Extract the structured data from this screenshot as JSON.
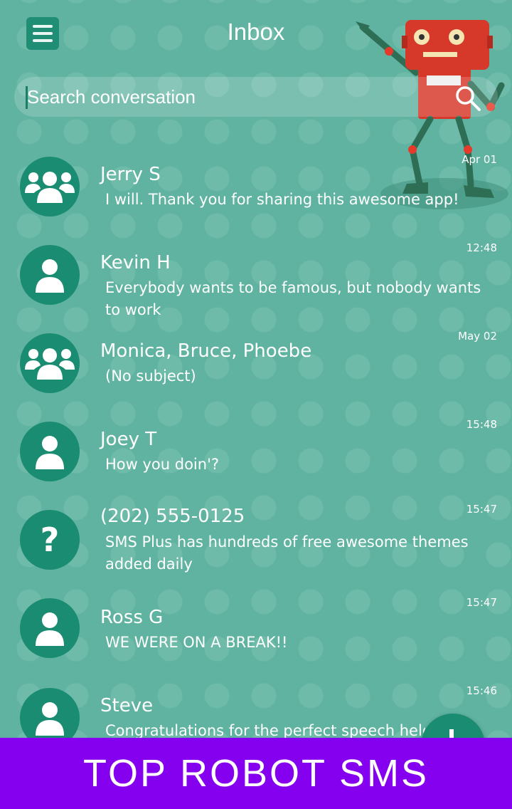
{
  "header": {
    "title": "Inbox",
    "menu_icon": "hamburger-menu-icon"
  },
  "search": {
    "placeholder": "Search conversation",
    "icon": "search-icon"
  },
  "conversations": [
    {
      "name": "Jerry S",
      "preview": "I will. Thank you for sharing this awesome app!",
      "time": "Apr 01",
      "avatar": "group-icon"
    },
    {
      "name": "Kevin H",
      "preview": "Everybody wants to be famous, but nobody wants to work",
      "time": "12:48",
      "avatar": "person-icon"
    },
    {
      "name": "Monica, Bruce, Phoebe",
      "preview": "(No subject)",
      "time": "May 02",
      "avatar": "group-icon"
    },
    {
      "name": "Joey T",
      "preview": "How you doin'?",
      "time": "15:48",
      "avatar": "person-icon"
    },
    {
      "name": "(202) 555-0125",
      "preview": "SMS Plus has hundreds of free awesome themes added daily",
      "time": "15:47",
      "avatar": "unknown-contact-icon"
    },
    {
      "name": "Ross G",
      "preview": "WE WERE ON A BREAK!!",
      "time": "15:47",
      "avatar": "person-icon"
    },
    {
      "name": "Steve",
      "preview": "Congratulations for the perfect speech held today!",
      "time": "15:46",
      "avatar": "person-icon"
    }
  ],
  "fab": {
    "icon": "plus-icon"
  },
  "banner": {
    "text": "TOP ROBOT SMS"
  },
  "colors": {
    "background": "#5fb3a0",
    "accent": "#1a8c71",
    "banner": "#8400ee"
  }
}
